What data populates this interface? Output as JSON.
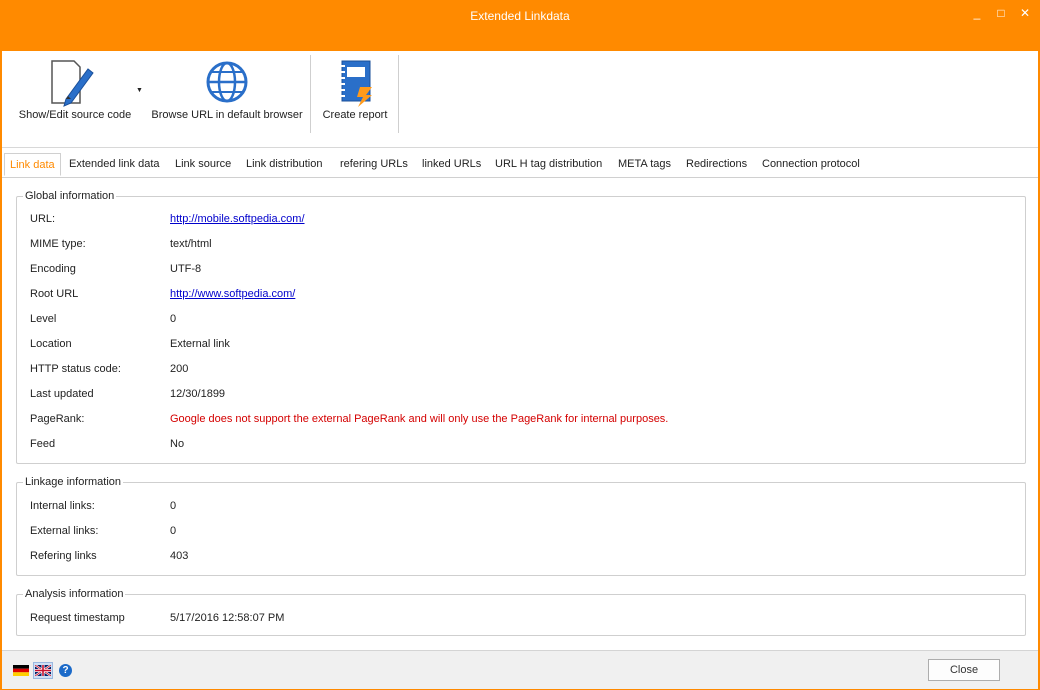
{
  "window": {
    "title": "Extended Linkdata",
    "controls": [
      "_",
      "□",
      "✕"
    ]
  },
  "toolbar": {
    "show_edit_label": "Show/Edit source code",
    "browse_label": "Browse URL in default browser",
    "report_label": "Create report"
  },
  "tabs": [
    "Link data",
    "Extended link data",
    "Link source",
    "Link distribution",
    "refering URLs",
    "linked URLs",
    "URL H tag distribution",
    "META tags",
    "Redirections",
    "Connection protocol"
  ],
  "global": {
    "title": "Global information",
    "rows": [
      {
        "key": "URL:",
        "value": "http://mobile.softpedia.com/"
      },
      {
        "key": "MIME type:",
        "value": "text/html"
      },
      {
        "key": "Encoding",
        "value": "UTF-8"
      },
      {
        "key": "Root URL",
        "value": "http://www.softpedia.com/"
      },
      {
        "key": "Level",
        "value": "0"
      },
      {
        "key": "Location",
        "value": "External link"
      },
      {
        "key": "HTTP status code:",
        "value": "200"
      },
      {
        "key": "Last updated",
        "value": "12/30/1899"
      },
      {
        "key": "PageRank:",
        "value": "Google does not support the external PageRank and will only use the PageRank for internal purposes."
      },
      {
        "key": "Feed",
        "value": "No"
      }
    ]
  },
  "linkage": {
    "title": "Linkage information",
    "rows": [
      {
        "key": "Internal links:",
        "value": "0"
      },
      {
        "key": "External links:",
        "value": "0"
      },
      {
        "key": "Refering links",
        "value": "403"
      }
    ]
  },
  "analysis": {
    "title": "Analysis information",
    "rows": [
      {
        "key": "Request timestamp",
        "value": "5/17/2016 12:58:07 PM"
      }
    ]
  },
  "footer": {
    "close_label": "Close",
    "help_label": "?"
  },
  "colors": {
    "accent": "#ff8a00",
    "link": "#0000cc",
    "warning": "#d40000"
  }
}
